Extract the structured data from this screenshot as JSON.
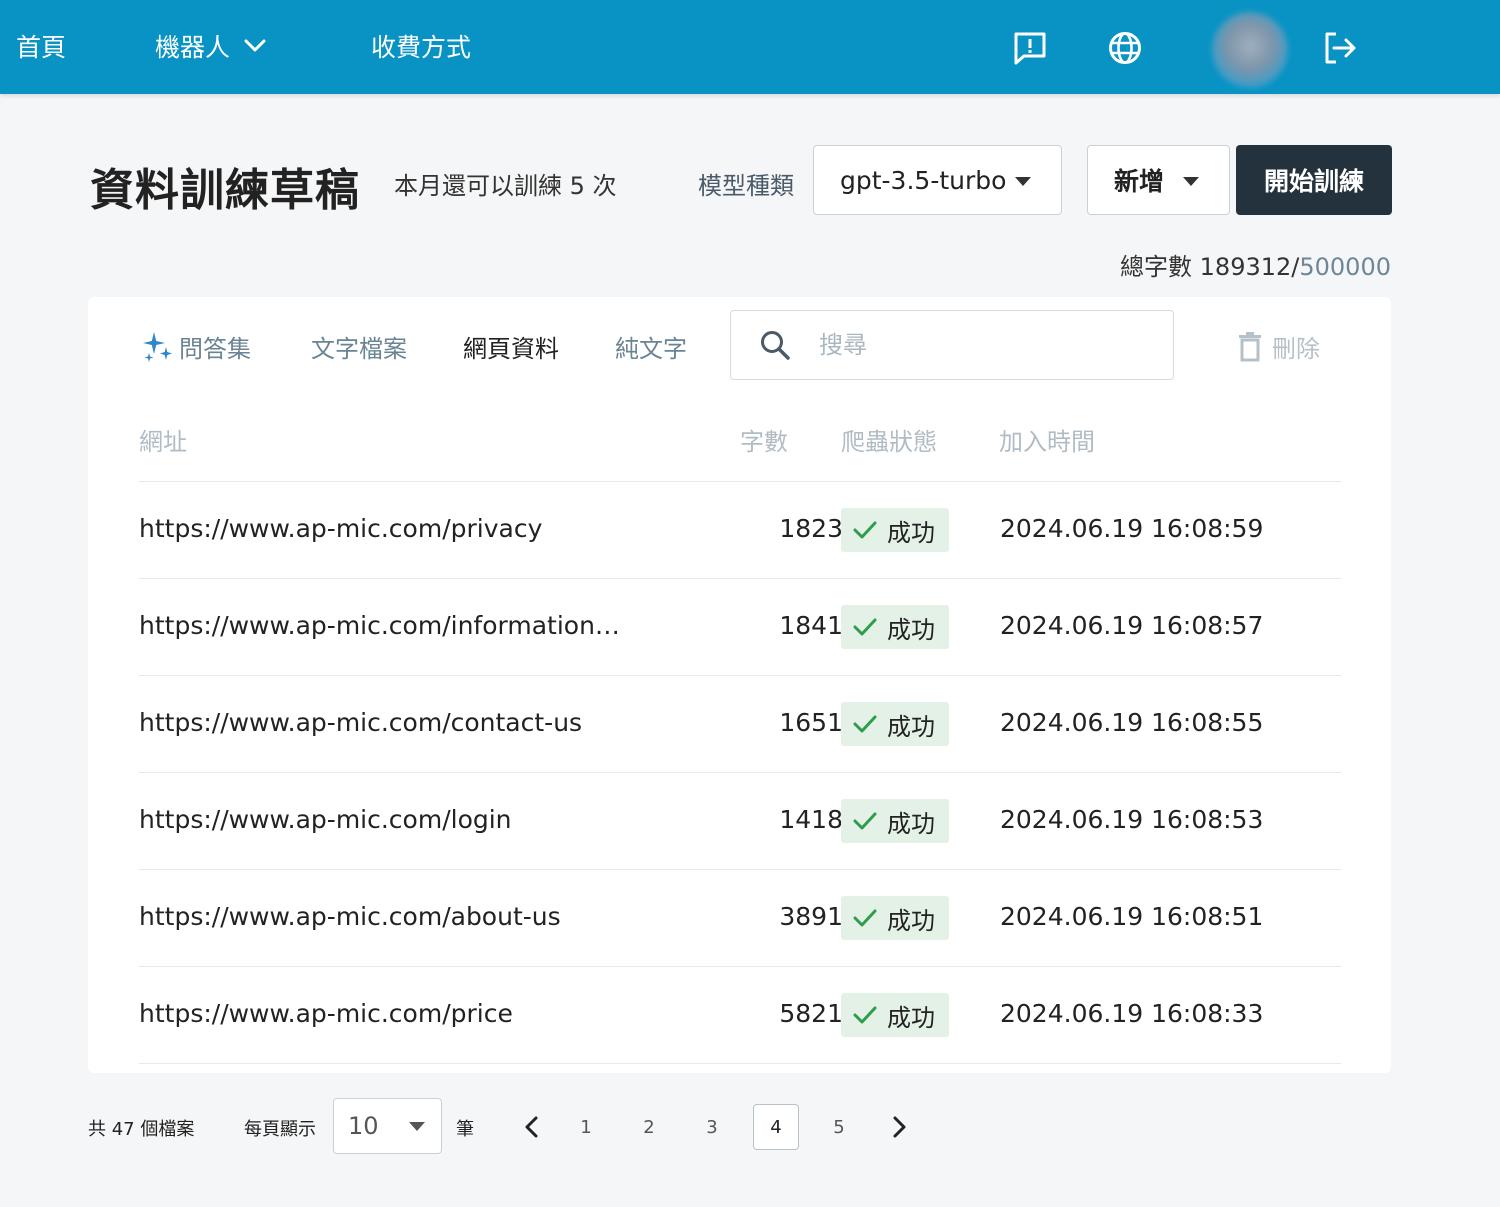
{
  "nav": {
    "home": "首頁",
    "robot": "機器人",
    "payment": "收費方式"
  },
  "header": {
    "title": "資料訓練草稿",
    "train_remaining": "本月還可以訓練 5 次",
    "model_label": "模型種類",
    "model_value": "gpt-3.5-turbo",
    "add_label": "新增",
    "start_label": "開始訓練",
    "word_total_prefix": "總字數 189312/",
    "word_total_limit": "500000"
  },
  "tabs": {
    "qa": "問答集",
    "text_file": "文字檔案",
    "web": "網頁資料",
    "plain": "純文字"
  },
  "search": {
    "placeholder": "搜尋"
  },
  "delete_label": "刪除",
  "table": {
    "headers": {
      "url": "網址",
      "count": "字數",
      "status": "爬蟲狀態",
      "time": "加入時間"
    },
    "rows": [
      {
        "url": "https://www.ap-mic.com/privacy",
        "count": "1823",
        "status": "成功",
        "time": "2024.06.19 16:08:59"
      },
      {
        "url": "https://www.ap-mic.com/information…",
        "count": "1841",
        "status": "成功",
        "time": "2024.06.19 16:08:57"
      },
      {
        "url": "https://www.ap-mic.com/contact-us",
        "count": "1651",
        "status": "成功",
        "time": "2024.06.19 16:08:55"
      },
      {
        "url": "https://www.ap-mic.com/login",
        "count": "1418",
        "status": "成功",
        "time": "2024.06.19 16:08:53"
      },
      {
        "url": "https://www.ap-mic.com/about-us",
        "count": "3891",
        "status": "成功",
        "time": "2024.06.19 16:08:51"
      },
      {
        "url": "https://www.ap-mic.com/price",
        "count": "5821",
        "status": "成功",
        "time": "2024.06.19 16:08:33"
      }
    ]
  },
  "footer": {
    "total_files": "共 47 個檔案",
    "per_page_label": "每頁顯示",
    "per_page_value": "10",
    "per_page_unit": "筆",
    "pages": [
      "1",
      "2",
      "3",
      "4",
      "5"
    ],
    "current_page": "4"
  },
  "colors": {
    "nav_bg": "#0893c4",
    "primary_button": "#24323d",
    "success_bg": "#e3f1e6",
    "success_check": "#2e9e4c"
  }
}
